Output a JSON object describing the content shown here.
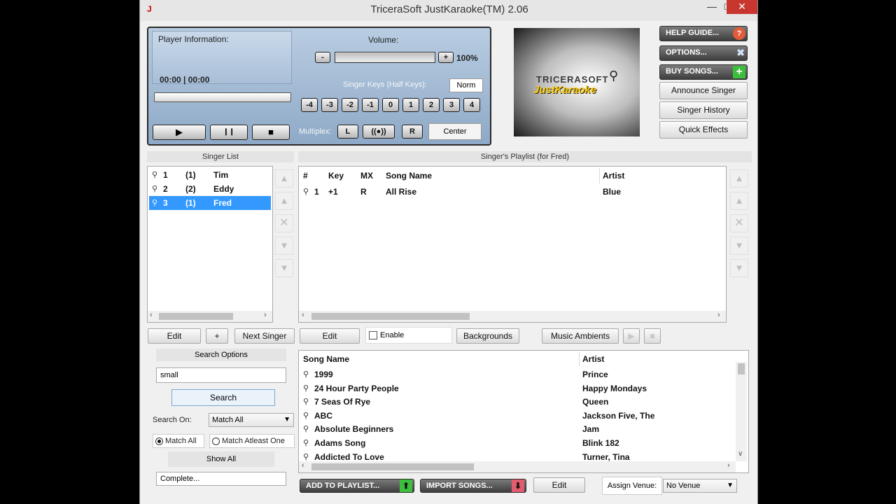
{
  "window": {
    "title": "TriceraSoft JustKaraoke(TM) 2.06",
    "app_icon": "J"
  },
  "player": {
    "info_label": "Player Information:",
    "time": "00:00 | 00:00",
    "volume_label": "Volume:",
    "volume_minus": "-",
    "volume_plus": "+",
    "volume_value": "100%",
    "volume_level": 1.0,
    "keys_label": "Singer Keys (Half Keys):",
    "keys_norm": "Norm",
    "keys": [
      "-4",
      "-3",
      "-2",
      "-1",
      "0",
      "1",
      "2",
      "3",
      "4"
    ],
    "multiplex_label": "Multiplex:",
    "multiplex_left": "L",
    "multiplex_both": "((●))",
    "multiplex_right": "R",
    "multiplex_center": "Center",
    "play": "▶",
    "pause": "❙❙",
    "stop": "■"
  },
  "logo": {
    "brand_top": "TRICERASOFT",
    "brand_bottom": "JustKaraoke"
  },
  "right_buttons": {
    "help": "HELP GUIDE...",
    "options": "OPTIONS...",
    "buy": "BUY SONGS...",
    "announce": "Announce Singer",
    "history": "Singer History",
    "effects": "Quick Effects"
  },
  "singer_list": {
    "header": "Singer List",
    "rows": [
      {
        "num": "1",
        "count": "(1)",
        "name": "Tim"
      },
      {
        "num": "2",
        "count": "(2)",
        "name": "Eddy"
      },
      {
        "num": "3",
        "count": "(1)",
        "name": "Fred"
      }
    ],
    "edit": "Edit",
    "add": "+",
    "next": "Next Singer"
  },
  "playlist": {
    "header": "Singer's Playlist (for Fred)",
    "columns": {
      "num": "#",
      "key": "Key",
      "mx": "MX",
      "song": "Song Name",
      "artist": "Artist"
    },
    "rows": [
      {
        "num": "1",
        "key": "+1",
        "mx": "R",
        "song": "All Rise",
        "artist": "Blue"
      }
    ],
    "edit": "Edit",
    "enable": "Enable",
    "backgrounds": "Backgrounds",
    "ambients": "Music Ambients"
  },
  "search": {
    "options": "Search Options",
    "query": "small",
    "button": "Search",
    "on_label": "Search On:",
    "on_value": "Match All",
    "radio_all": "Match All",
    "radio_atleast": "Match Atleast One",
    "show_all": "Show All",
    "status": "Complete..."
  },
  "songs": {
    "columns": {
      "song": "Song Name",
      "artist": "Artist"
    },
    "rows": [
      {
        "song": "1999",
        "artist": "Prince"
      },
      {
        "song": "24 Hour Party People",
        "artist": "Happy Mondays"
      },
      {
        "song": "7 Seas Of Rye",
        "artist": "Queen"
      },
      {
        "song": "ABC",
        "artist": "Jackson Five, The"
      },
      {
        "song": "Absolute Beginners",
        "artist": "Jam"
      },
      {
        "song": "Adams Song",
        "artist": "Blink 182"
      },
      {
        "song": "Addicted To Love",
        "artist": "Turner, Tina"
      }
    ]
  },
  "bottom": {
    "add_to_playlist": "ADD TO PLAYLIST...",
    "import_songs": "IMPORT SONGS...",
    "edit": "Edit",
    "venue_label": "Assign Venue:",
    "venue_value": "No Venue"
  }
}
